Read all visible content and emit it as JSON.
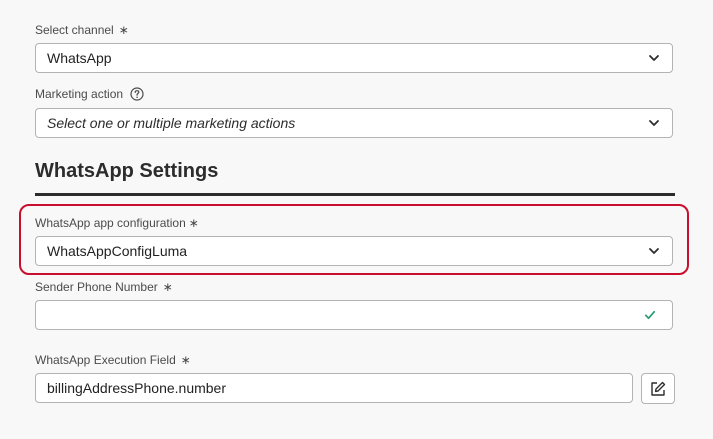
{
  "channel": {
    "label": "Select channel",
    "required_mark": "∗",
    "value": "WhatsApp"
  },
  "marketing_action": {
    "label": "Marketing action",
    "placeholder": "Select one or multiple marketing actions"
  },
  "settings": {
    "heading": "WhatsApp Settings"
  },
  "config": {
    "label": "WhatsApp app configuration",
    "required_mark": "∗",
    "value": "WhatsAppConfigLuma"
  },
  "sender": {
    "label": "Sender Phone Number",
    "required_mark": "∗",
    "value": ""
  },
  "execution_field": {
    "label": "WhatsApp Execution Field",
    "required_mark": "∗",
    "value": "billingAddressPhone.number"
  },
  "icons": {
    "help": "help-circle-icon",
    "chevron": "chevron-down-icon",
    "valid": "checkmark-icon",
    "edit": "edit-icon"
  },
  "colors": {
    "highlight": "#c8102e",
    "valid": "#2d9d78"
  }
}
